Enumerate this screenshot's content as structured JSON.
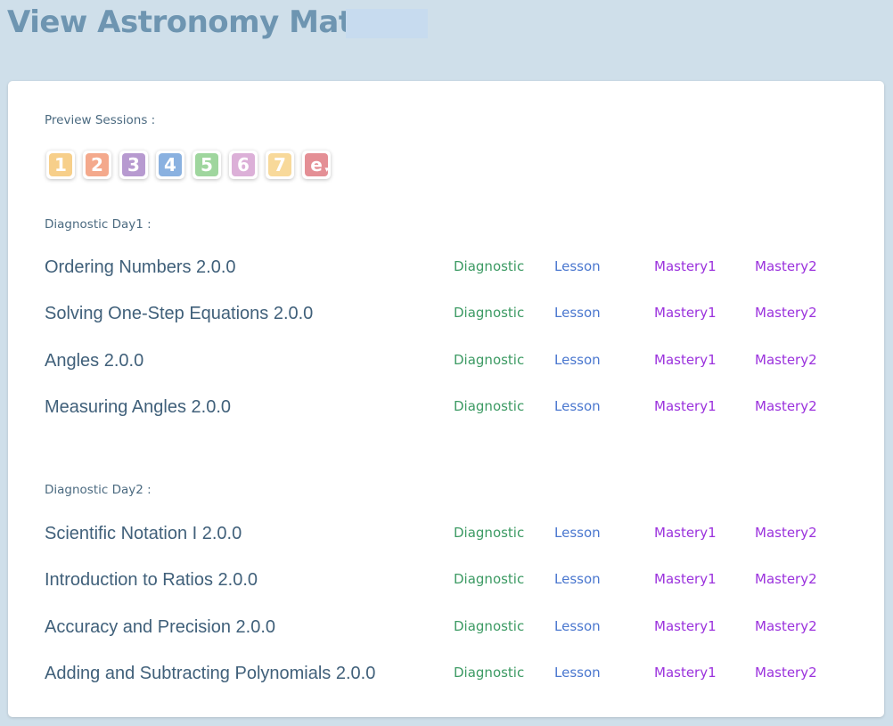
{
  "title": "View Astronomy Math",
  "preview_label": "Preview Sessions :",
  "sessions": [
    {
      "label": "1",
      "color": "#f7cf8a"
    },
    {
      "label": "2",
      "color": "#f4a98c"
    },
    {
      "label": "3",
      "color": "#b79ad0"
    },
    {
      "label": "4",
      "color": "#8ab1e0"
    },
    {
      "label": "5",
      "color": "#9fd69e"
    },
    {
      "label": "6",
      "color": "#dcb0d8"
    },
    {
      "label": "7",
      "color": "#f8d99a"
    },
    {
      "label": "e",
      "color": "#e48f95",
      "dropdown": "▾"
    }
  ],
  "days": [
    {
      "label": "Diagnostic Day1 :",
      "rows": [
        {
          "name": "Ordering Numbers 2.0.0",
          "diagnostic": "Diagnostic",
          "lesson": "Lesson",
          "mastery1": "Mastery1",
          "mastery2": "Mastery2"
        },
        {
          "name": "Solving One-Step Equations 2.0.0",
          "diagnostic": "Diagnostic",
          "lesson": "Lesson",
          "mastery1": "Mastery1",
          "mastery2": "Mastery2"
        },
        {
          "name": "Angles 2.0.0",
          "diagnostic": "Diagnostic",
          "lesson": "Lesson",
          "mastery1": "Mastery1",
          "mastery2": "Mastery2"
        },
        {
          "name": "Measuring Angles 2.0.0",
          "diagnostic": "Diagnostic",
          "lesson": "Lesson",
          "mastery1": "Mastery1",
          "mastery2": "Mastery2"
        }
      ]
    },
    {
      "label": "Diagnostic Day2 :",
      "rows": [
        {
          "name": "Scientific Notation I 2.0.0",
          "diagnostic": "Diagnostic",
          "lesson": "Lesson",
          "mastery1": "Mastery1",
          "mastery2": "Mastery2"
        },
        {
          "name": "Introduction to Ratios 2.0.0",
          "diagnostic": "Diagnostic",
          "lesson": "Lesson",
          "mastery1": "Mastery1",
          "mastery2": "Mastery2"
        },
        {
          "name": "Accuracy and Precision 2.0.0",
          "diagnostic": "Diagnostic",
          "lesson": "Lesson",
          "mastery1": "Mastery1",
          "mastery2": "Mastery2"
        },
        {
          "name": "Adding and Subtracting Polynomials 2.0.0",
          "diagnostic": "Diagnostic",
          "lesson": "Lesson",
          "mastery1": "Mastery1",
          "mastery2": "Mastery2"
        }
      ]
    }
  ]
}
